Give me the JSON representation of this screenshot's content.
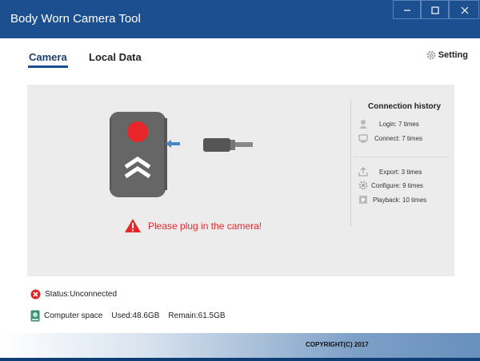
{
  "window": {
    "title": "Body Worn Camera Tool"
  },
  "tabs": [
    {
      "label": "Camera",
      "active": true
    },
    {
      "label": "Local Data",
      "active": false
    }
  ],
  "setting": {
    "label": "Setting",
    "icon": "gear-icon"
  },
  "main": {
    "warning": "Please plug in the camera!"
  },
  "history": {
    "title": "Connection history",
    "items": [
      {
        "label": "Login: 7 times",
        "icon": "user-icon"
      },
      {
        "label": "Connect: 7 times",
        "icon": "monitor-icon"
      },
      {
        "label": "Export: 3 times",
        "icon": "export-icon"
      },
      {
        "label": "Configure: 9 times",
        "icon": "gear-icon"
      },
      {
        "label": "Playback: 10 times",
        "icon": "playback-icon"
      }
    ]
  },
  "status": {
    "text": "Status:Unconnected",
    "icon": "error-icon"
  },
  "storage": {
    "label": "Computer space",
    "used": "Used:48.6GB",
    "remain": "Remain:61.5GB",
    "icon": "disk-icon"
  },
  "footer": {
    "copyright": "COPYRIGHT(C) 2017"
  },
  "colors": {
    "titlebar": "#1b4f8f",
    "warning": "#e8262a",
    "panel": "#ececec"
  }
}
